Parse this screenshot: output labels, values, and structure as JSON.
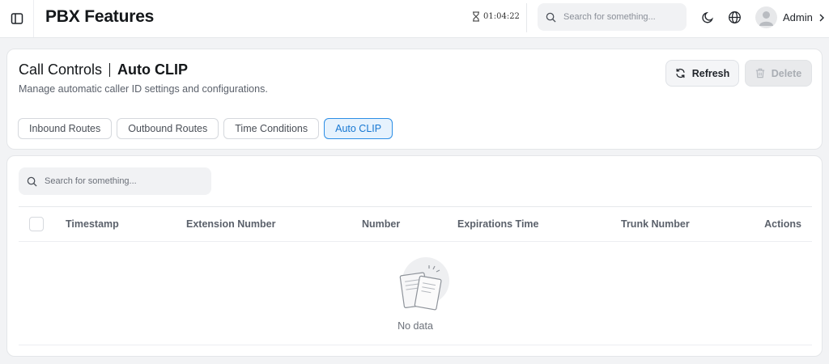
{
  "header": {
    "title": "PBX Features",
    "timer": "01:04:22",
    "search_placeholder": "Search for something...",
    "user_name": "Admin"
  },
  "page": {
    "breadcrumb_parent": "Call Controls",
    "breadcrumb_current": "Auto CLIP",
    "subtitle": "Manage automatic caller ID settings and configurations.",
    "refresh_label": "Refresh",
    "delete_label": "Delete",
    "tabs": [
      {
        "label": "Inbound Routes",
        "active": false
      },
      {
        "label": "Outbound Routes",
        "active": false
      },
      {
        "label": "Time Conditions",
        "active": false
      },
      {
        "label": "Auto CLIP",
        "active": true
      }
    ]
  },
  "table": {
    "search_placeholder": "Search for something...",
    "columns": [
      "Timestamp",
      "Extension Number",
      "Number",
      "Expirations Time",
      "Trunk Number",
      "Actions"
    ],
    "rows": [],
    "empty_text": "No data"
  },
  "colors": {
    "accent": "#1677d2",
    "active_tab_bg": "#e6f2fd",
    "background": "#f2f3f5"
  },
  "icons": {
    "sidebar_toggle": "sidebar-toggle-icon",
    "timer": "hourglass-icon",
    "search": "search-icon",
    "theme": "moon-icon",
    "language": "globe-icon",
    "user": "user-icon",
    "chevron": "chevron-right-icon",
    "refresh": "refresh-icon",
    "delete": "trash-icon"
  }
}
